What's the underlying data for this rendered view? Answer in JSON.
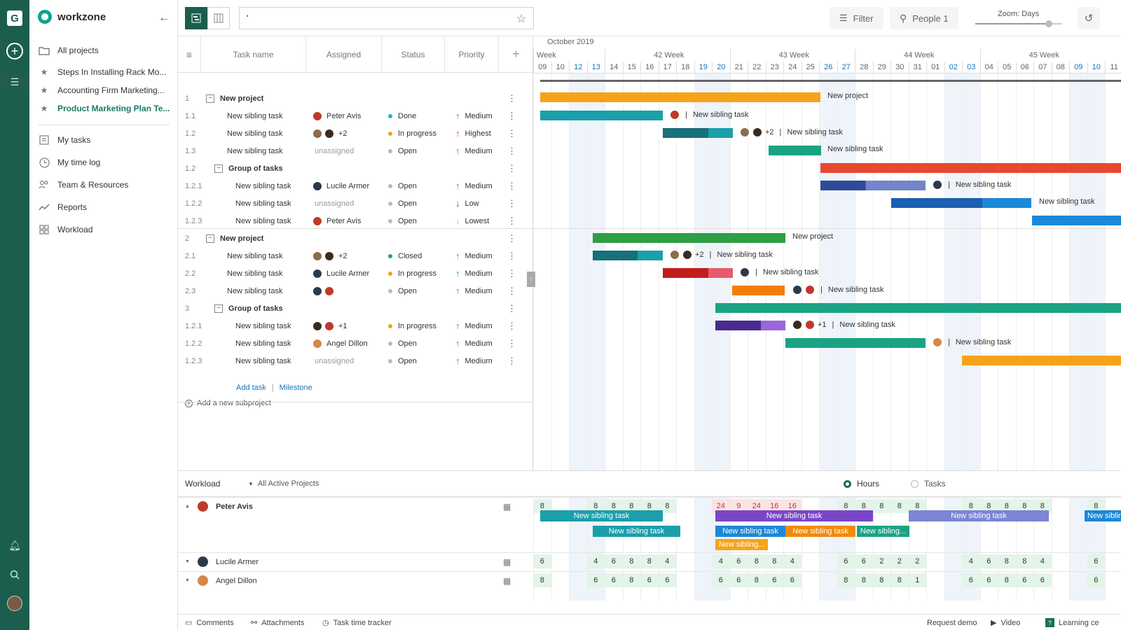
{
  "app": {
    "name": "workzone",
    "rail_letter": "G"
  },
  "sidebar": {
    "all_projects": "All projects",
    "starred": [
      {
        "label": "Steps In Installing Rack Mo..."
      },
      {
        "label": "Accounting Firm Marketing..."
      },
      {
        "label": "Product Marketing Plan Te..."
      }
    ],
    "nav": [
      {
        "label": "My tasks",
        "icon": "list-icon"
      },
      {
        "label": "My time log",
        "icon": "clock-icon"
      },
      {
        "label": "Team & Resources",
        "icon": "team-icon"
      },
      {
        "label": "Reports",
        "icon": "reports-icon"
      },
      {
        "label": "Workload",
        "icon": "workload-icon"
      }
    ]
  },
  "toolbar": {
    "search_value": "'",
    "filter_label": "Filter",
    "people_label": "People 1",
    "zoom_label": "Zoom: Days",
    "zoom_level": 0.85
  },
  "grid": {
    "headers": {
      "task": "Task name",
      "assigned": "Assigned",
      "status": "Status",
      "priority": "Priority"
    },
    "rows": [
      {
        "num": "1",
        "name": "New project",
        "kind": "project"
      },
      {
        "num": "1.1",
        "name": "New sibling task",
        "assigned": "Peter Avis",
        "avatars": [
          "#c0392b"
        ],
        "status": "Done",
        "status_color": "#24b5c2",
        "priority": "Medium",
        "prio_dir": "up",
        "prio_color": "#1ea784"
      },
      {
        "num": "1.2",
        "name": "New sibling task",
        "assigned": "+2",
        "avatars": [
          "#8a6d4a",
          "#3b2a20"
        ],
        "status": "In progress",
        "status_color": "#f4a020",
        "priority": "Highest",
        "prio_dir": "up",
        "prio_color": "#e2443a"
      },
      {
        "num": "1.3",
        "name": "New sibling task",
        "assigned": "unassigned",
        "avatars": [],
        "status": "Open",
        "status_color": "#bbbbbb",
        "priority": "Medium",
        "prio_dir": "up",
        "prio_color": "#1ea784"
      },
      {
        "num": "1.2",
        "name": "Group of tasks",
        "kind": "group"
      },
      {
        "num": "1.2.1",
        "name": "New sibling task",
        "assigned": "Lucile Armer",
        "avatars": [
          "#2b3a4a"
        ],
        "status": "Open",
        "status_color": "#bbbbbb",
        "priority": "Medium",
        "prio_dir": "up",
        "prio_color": "#1ea784"
      },
      {
        "num": "1.2.2",
        "name": "New sibling task",
        "assigned": "unassigned",
        "avatars": [],
        "status": "Open",
        "status_color": "#bbbbbb",
        "priority": "Low",
        "prio_dir": "down",
        "prio_color": "#555555"
      },
      {
        "num": "1.2.3",
        "name": "New sibling task",
        "assigned": "Peter Avis",
        "avatars": [
          "#c0392b"
        ],
        "status": "Open",
        "status_color": "#bbbbbb",
        "priority": "Lowest",
        "prio_dir": "down",
        "prio_color": "#bbbbbb"
      },
      {
        "num": "2",
        "name": "New project",
        "kind": "project"
      },
      {
        "num": "2.1",
        "name": "New sibling task",
        "assigned": "+2",
        "avatars": [
          "#8a6d4a",
          "#3b2a20"
        ],
        "status": "Closed",
        "status_color": "#1ea784",
        "priority": "Medium",
        "prio_dir": "up",
        "prio_color": "#1ea784"
      },
      {
        "num": "2.2",
        "name": "New sibling task",
        "assigned": "Lucile Armer",
        "avatars": [
          "#2b3a4a"
        ],
        "status": "In progress",
        "status_color": "#f4a020",
        "priority": "Medium",
        "prio_dir": "up",
        "prio_color": "#1ea784"
      },
      {
        "num": "2.3",
        "name": "New sibling task",
        "assigned": "",
        "avatars": [
          "#2b3a4a",
          "#c0392b"
        ],
        "status": "Open",
        "status_color": "#bbbbbb",
        "priority": "Medium",
        "prio_dir": "up",
        "prio_color": "#1ea784"
      },
      {
        "num": "3",
        "name": "Group of tasks",
        "kind": "group"
      },
      {
        "num": "1.2.1",
        "name": "New sibling task",
        "assigned": "+1",
        "avatars": [
          "#3b2a20",
          "#c0392b"
        ],
        "status": "In progress",
        "status_color": "#f4a020",
        "priority": "Medium",
        "prio_dir": "up",
        "prio_color": "#1ea784"
      },
      {
        "num": "1.2.2",
        "name": "New sibling task",
        "assigned": "Angel Dillon",
        "avatars": [
          "#d4884a"
        ],
        "status": "Open",
        "status_color": "#bbbbbb",
        "priority": "Medium",
        "prio_dir": "up",
        "prio_color": "#1ea784"
      },
      {
        "num": "1.2.3",
        "name": "New sibling task",
        "assigned": "unassigned",
        "avatars": [],
        "status": "Open",
        "status_color": "#bbbbbb",
        "priority": "Medium",
        "prio_dir": "up",
        "prio_color": "#1ea784"
      }
    ],
    "add_task": "Add task",
    "separator": "|",
    "milestone": "Milestone",
    "add_subproject": "Add a new subproject"
  },
  "gantt": {
    "month": "October 2019",
    "weeks": [
      "Week",
      "42 Week",
      "43 Week",
      "44 Week",
      "45 Week"
    ],
    "days": [
      "09",
      "10",
      "12",
      "13",
      "14",
      "15",
      "16",
      "17",
      "18",
      "19",
      "20",
      "21",
      "22",
      "23",
      "24",
      "25",
      "26",
      "27",
      "28",
      "29",
      "30",
      "31",
      "01",
      "02",
      "03",
      "04",
      "05",
      "06",
      "07",
      "08",
      "09",
      "10",
      "11"
    ],
    "weekend_days": [
      2,
      3,
      9,
      10,
      16,
      17,
      23,
      24,
      30,
      31
    ],
    "summary_label_1": "New project",
    "summary_label_2": "New project",
    "task_label": "New sibling task",
    "divider": "|",
    "plus2": "+2",
    "plus1": "+1",
    "colors": {
      "teal": "#1a9fab",
      "dark_teal": "#17707a",
      "orange": "#f7a21b",
      "red": "#e8492e",
      "navy": "#2e4a9b",
      "blue": "#1c88d8",
      "green": "#2f9e44",
      "purple": "#6a3fb5",
      "green_teal": "#1aa383"
    }
  },
  "workload": {
    "title": "Workload",
    "filter": "All Active Projects",
    "mode_hours": "Hours",
    "mode_tasks": "Tasks",
    "people": [
      {
        "name": "Peter Avis",
        "avatar": "#c0392b",
        "cells": [
          "8",
          "",
          "",
          "8",
          "8",
          "8",
          "8",
          "8",
          "",
          "",
          "24",
          "9",
          "24",
          "16",
          "16",
          "",
          "",
          "8",
          "8",
          "8",
          "8",
          "8",
          "",
          "",
          "8",
          "8",
          "8",
          "8",
          "8",
          "",
          "",
          "8"
        ]
      },
      {
        "name": "Lucile Armer",
        "avatar": "#2b3a4a",
        "cells": [
          "6",
          "",
          "",
          "4",
          "6",
          "8",
          "8",
          "4",
          "",
          "",
          "4",
          "6",
          "8",
          "8",
          "4",
          "",
          "",
          "6",
          "6",
          "2",
          "2",
          "2",
          "",
          "",
          "4",
          "6",
          "8",
          "8",
          "4",
          "",
          "",
          "6"
        ]
      },
      {
        "name": "Angel Dillon",
        "avatar": "#d4884a",
        "cells": [
          "8",
          "",
          "",
          "6",
          "6",
          "8",
          "6",
          "6",
          "",
          "",
          "6",
          "6",
          "8",
          "6",
          "6",
          "",
          "",
          "8",
          "8",
          "8",
          "8",
          "1",
          "",
          "",
          "6",
          "6",
          "8",
          "6",
          "6",
          "",
          "",
          "6"
        ]
      }
    ],
    "bar_labels": {
      "a": "New sibling task",
      "b": "New sibling task",
      "c": "New sibling task",
      "d": "New sibling task",
      "e": "New sibling task",
      "f": "New sibling task",
      "g": "New sibling...",
      "h": "New sibling...",
      "i": "New sibling task"
    }
  },
  "bottom": {
    "comments": "Comments",
    "attachments": "Attachments",
    "tracker": "Task time tracker",
    "request_demo": "Request demo",
    "video": "Video",
    "learning": "Learning ce"
  }
}
